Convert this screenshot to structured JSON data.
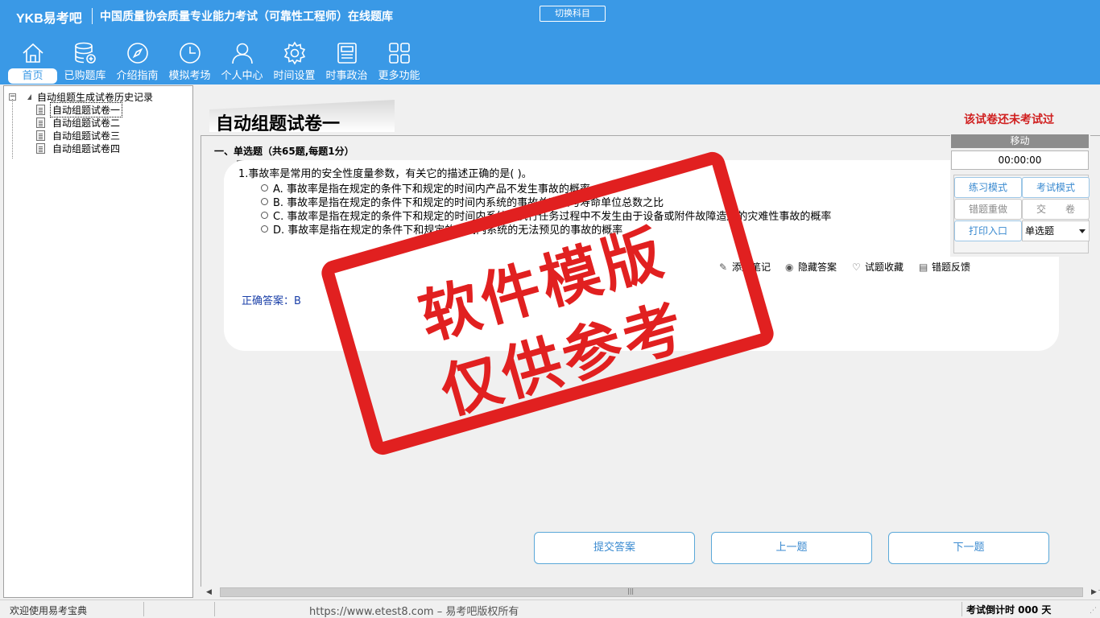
{
  "header": {
    "brand": "YKB易考吧",
    "title": "中国质量协会质量专业能力考试（可靠性工程师）在线题库",
    "switch_button": "切换科目"
  },
  "nav": [
    {
      "label": "首页",
      "icon": "home-icon",
      "active": true
    },
    {
      "label": "已购题库",
      "icon": "database-icon"
    },
    {
      "label": "介绍指南",
      "icon": "compass-icon"
    },
    {
      "label": "模拟考场",
      "icon": "clock-icon"
    },
    {
      "label": "个人中心",
      "icon": "user-icon"
    },
    {
      "label": "时间设置",
      "icon": "gear-icon"
    },
    {
      "label": "时事政治",
      "icon": "newspaper-icon"
    },
    {
      "label": "更多功能",
      "icon": "grid-icon"
    }
  ],
  "tree": {
    "root": "自动组题生成试卷历史记录",
    "items": [
      "自动组题试卷一",
      "自动组题试卷二",
      "自动组题试卷三",
      "自动组题试卷四"
    ],
    "selected_index": 0
  },
  "paper": {
    "title": "自动组题试卷一",
    "status": "该试卷还未考试过",
    "section": "一、单选题（共65题,每题1分）",
    "question": "1.事故率是常用的安全性度量参数，有关它的描述正确的是( )。",
    "options": [
      "A. 事故率是指在规定的条件下和规定的时间内产品不发生事故的概率",
      "B. 事故率是指在规定的条件下和规定的时间内系统的事故总次数与寿命单位总数之比",
      "C. 事故率是指在规定的条件下和规定的时间内系统在执行任务过程中不发生由于设备或附件故障造成的灾难性事故的概率",
      "D. 事故率是指在规定的条件下和规定的时间内系统的无法预见的事故的概率"
    ],
    "tools": [
      "添加笔记",
      "隐藏答案",
      "试题收藏",
      "错题反馈"
    ],
    "answer": "正确答案：B"
  },
  "buttons": {
    "submit": "提交答案",
    "prev": "上一题",
    "next": "下一题"
  },
  "panel": {
    "header": "移动",
    "timer": "00:00:00",
    "practice": "练习模式",
    "exam": "考试模式",
    "redo_wrong": "错题重做",
    "hand_in": "交　　卷",
    "print": "打印入口",
    "type_select": "单选题"
  },
  "watermark": {
    "line1": "软件模版",
    "line2": "仅供参考"
  },
  "status": {
    "welcome": "欢迎使用易考宝典",
    "copyright": "https://www.etest8.com – 易考吧版权所有",
    "countdown": "考试倒计时 000 天"
  },
  "colors": {
    "header_bg": "#3a99e6",
    "accent": "#3a8ad0",
    "warning": "#d02020",
    "stamp": "#e12020"
  }
}
